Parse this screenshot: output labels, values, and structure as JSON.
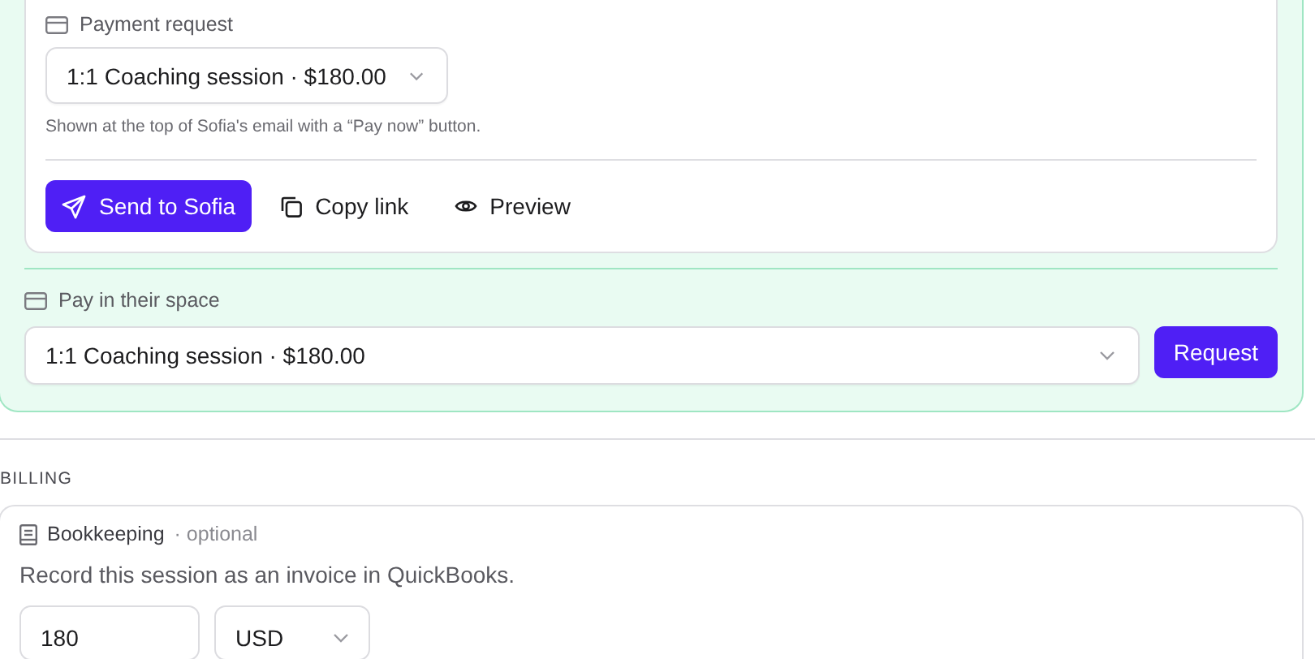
{
  "payment_request": {
    "label": "Payment request",
    "select": {
      "value": "1:1 Coaching session · $180.00"
    },
    "hint": "Shown at the top of Sofia's email with a “Pay now” button.",
    "actions": [
      {
        "kind": "primary",
        "label": "Send to Sofia"
      },
      {
        "kind": "copy",
        "label": "Copy link"
      },
      {
        "kind": "preview",
        "label": "Preview"
      }
    ]
  },
  "pay_in_space": {
    "label": "Pay in their space",
    "select": {
      "value": "1:1 Coaching session · $180.00"
    },
    "button": "Request"
  },
  "billing": {
    "heading": "BILLING",
    "bookkeeping": {
      "title": "Bookkeeping",
      "note": "· optional",
      "description": "Record this session as an invoice in QuickBooks.",
      "amount": "180",
      "currency": "USD"
    }
  }
}
